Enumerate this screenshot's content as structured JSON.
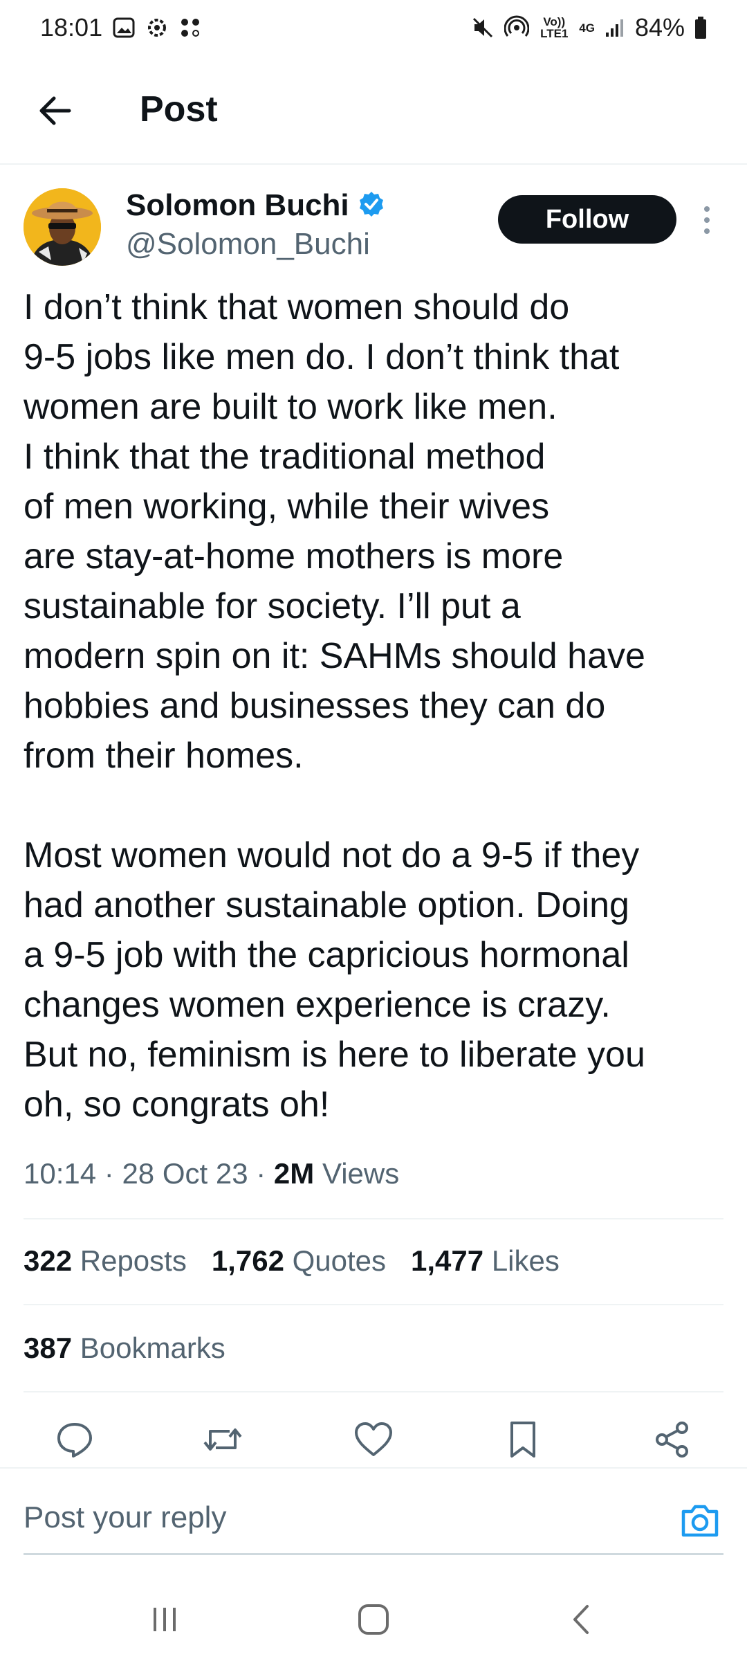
{
  "status_bar": {
    "time": "18:01",
    "network_top": "Vo)) LTE1",
    "network_gen": "4G",
    "battery": "84%",
    "icons": [
      "gallery-icon",
      "settings-icon",
      "dots-icon",
      "mute-icon",
      "hotspot-icon",
      "signal-icon",
      "battery-icon"
    ]
  },
  "header": {
    "title": "Post"
  },
  "author": {
    "display_name": "Solomon Buchi",
    "handle": "@Solomon_Buchi",
    "verified": true,
    "follow_label": "Follow"
  },
  "tweet": {
    "text": "I don’t think that women should do\n9-5 jobs like men do. I don’t think that\nwomen are built to work like men.\nI think that the traditional method\nof men working, while their wives\nare stay-at-home mothers is more\nsustainable for society. I’ll put a\nmodern spin on it: SAHMs should have\nhobbies and businesses they can do\nfrom their homes.\n\nMost women would not do a 9-5 if they\nhad another sustainable option. Doing\na 9-5 job with the capricious hormonal\nchanges women experience is crazy.\nBut no, feminism is here to liberate you\noh, so congrats oh!"
  },
  "meta": {
    "time": "10:14",
    "date": "28 Oct 23",
    "views_count": "2M",
    "views_label": "Views",
    "separator": "·"
  },
  "stats": {
    "reposts_count": "322",
    "reposts_label": "Reposts",
    "quotes_count": "1,762",
    "quotes_label": "Quotes",
    "likes_count": "1,477",
    "likes_label": "Likes",
    "bookmarks_count": "387",
    "bookmarks_label": "Bookmarks"
  },
  "reply": {
    "placeholder": "Post your reply"
  },
  "colors": {
    "accent": "#1d9bf0",
    "text": "#0f1419",
    "muted": "#536471",
    "divider": "#eff3f4"
  }
}
